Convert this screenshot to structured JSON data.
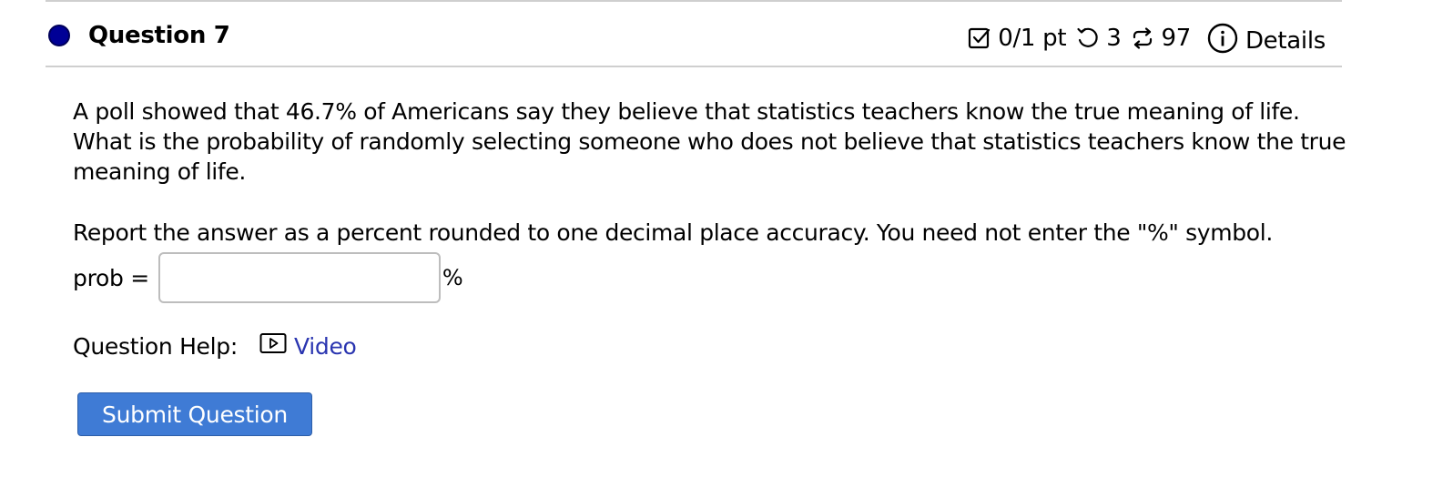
{
  "question": {
    "title": "Question 7",
    "status_color": "#000096"
  },
  "meta": {
    "points": "0/1 pt",
    "retries": "3",
    "attempts": "97",
    "details_label": "Details",
    "icons": [
      "checkbox-check-icon",
      "undo-icon",
      "repeat-icon",
      "info-circle-icon"
    ]
  },
  "body": {
    "paragraph1": "A poll showed that 46.7% of Americans say they believe that statistics teachers know the true meaning of life. What is the probability of randomly selecting someone who does not believe that statistics teachers know the true meaning of life.",
    "paragraph2": "Report the answer as a percent rounded to one decimal place accuracy. You need not enter the \"%\" symbol."
  },
  "answer": {
    "label": "prob =",
    "value": "",
    "unit": "%"
  },
  "help": {
    "label": "Question Help:",
    "video_label": "Video",
    "link_color": "#2a35b0"
  },
  "submit": {
    "label": "Submit Question",
    "color": "#3f7bd5"
  }
}
